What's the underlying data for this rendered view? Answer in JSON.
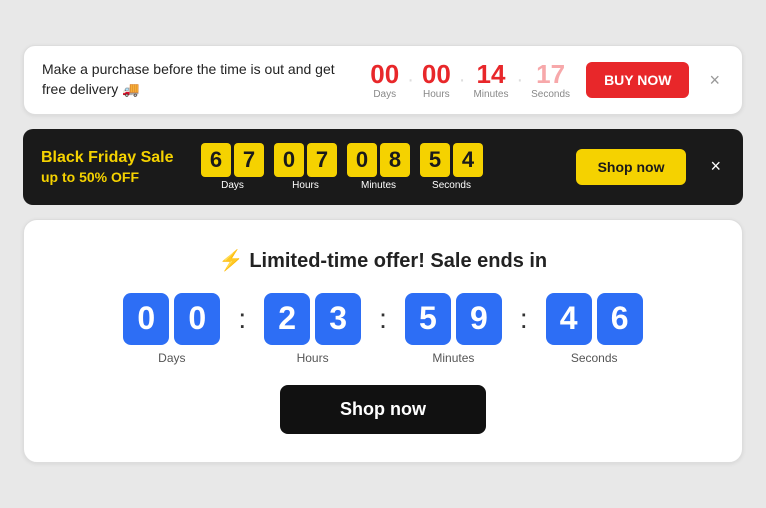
{
  "delivery_banner": {
    "message": "Make a purchase before the time is out and get free delivery 🚚",
    "countdown": {
      "days": {
        "value": "00",
        "label": "Days"
      },
      "hours": {
        "value": "00",
        "label": "Hours"
      },
      "minutes": {
        "value": "14",
        "label": "Minutes"
      },
      "seconds": {
        "value": "17",
        "label": "Seconds"
      }
    },
    "buy_now_label": "BUY NOW",
    "close_label": "×"
  },
  "bf_banner": {
    "title": "Black Friday Sale",
    "subtitle": "up to 50% OFF",
    "countdown": {
      "days": {
        "d1": "6",
        "d2": "7",
        "label": "Days"
      },
      "hours": {
        "d1": "0",
        "d2": "7",
        "label": "Hours"
      },
      "minutes": {
        "d1": "0",
        "d2": "8",
        "label": "Minutes"
      },
      "seconds": {
        "d1": "5",
        "d2": "4",
        "label": "Seconds"
      }
    },
    "shop_now_label": "Shop now",
    "close_label": "×"
  },
  "sale_banner": {
    "title": "⚡ Limited-time offer! Sale ends in",
    "countdown": {
      "days": {
        "d1": "0",
        "d2": "0",
        "label": "Days"
      },
      "hours": {
        "d1": "2",
        "d2": "3",
        "label": "Hours"
      },
      "minutes": {
        "d1": "5",
        "d2": "9",
        "label": "Minutes"
      },
      "seconds": {
        "d1": "4",
        "d2": "6",
        "label": "Seconds"
      }
    },
    "shop_now_label": "Shop now"
  }
}
